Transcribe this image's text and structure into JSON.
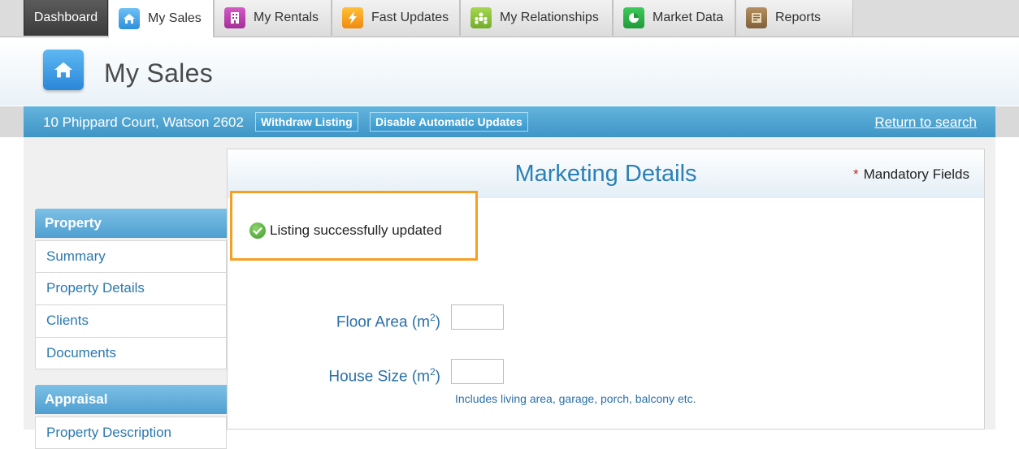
{
  "tabs": [
    {
      "label": "Dashboard",
      "icon": "dashboard-tab",
      "color": "#3b3b3b"
    },
    {
      "label": "My Sales",
      "icon": "home-icon",
      "color": "#3a9ae6"
    },
    {
      "label": "My Rentals",
      "icon": "rentals-icon",
      "color": "#c23fb3"
    },
    {
      "label": "Fast Updates",
      "icon": "lightning-icon",
      "color": "#f6a21c"
    },
    {
      "label": "My Relationships",
      "icon": "people-icon",
      "color": "#8dc63f"
    },
    {
      "label": "Market Data",
      "icon": "pie-chart-icon",
      "color": "#2fb34a"
    },
    {
      "label": "Reports",
      "icon": "report-icon",
      "color": "#a0784b"
    }
  ],
  "header": {
    "title": "My Sales"
  },
  "address_bar": {
    "address": "10 Phippard Court, Watson 2602",
    "withdraw_label": "Withdraw Listing",
    "disable_label": "Disable Automatic Updates",
    "return_label": "Return to search"
  },
  "sidebar": {
    "property_heading": "Property",
    "property_items": [
      "Summary",
      "Property Details",
      "Clients",
      "Documents"
    ],
    "appraisal_heading": "Appraisal",
    "appraisal_items": [
      "Property Description"
    ]
  },
  "panel": {
    "title": "Marketing Details",
    "mandatory_star": "*",
    "mandatory_label": "Mandatory Fields",
    "success_message": "Listing successfully updated",
    "fields": [
      {
        "label": "Floor Area (m",
        "sup": "2",
        "close": ")",
        "value": ""
      },
      {
        "label": "House Size (m",
        "sup": "2",
        "close": ")",
        "value": ""
      }
    ],
    "house_size_hint": "Includes living area, garage, porch, balcony etc."
  }
}
